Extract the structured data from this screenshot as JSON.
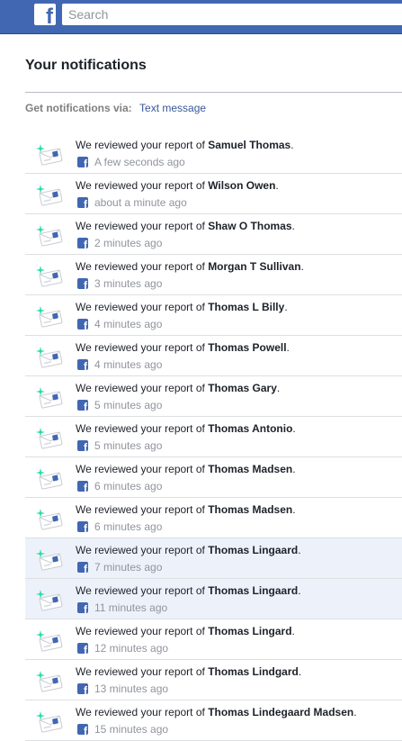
{
  "header": {
    "logo_glyph": "f",
    "search_placeholder": "Search",
    "brand_color": "#4267b2"
  },
  "page": {
    "title": "Your notifications",
    "via_label": "Get notifications via:",
    "via_link": "Text message"
  },
  "notification_icon": "support-inbox-envelope-icon",
  "notifications": [
    {
      "prefix": "We reviewed your report of ",
      "name": "Samuel Thomas",
      "suffix": ".",
      "time": "A few seconds ago",
      "unread": false
    },
    {
      "prefix": "We reviewed your report of ",
      "name": "Wilson Owen",
      "suffix": ".",
      "time": "about a minute ago",
      "unread": false
    },
    {
      "prefix": "We reviewed your report of ",
      "name": "Shaw O Thomas",
      "suffix": ".",
      "time": "2 minutes ago",
      "unread": false
    },
    {
      "prefix": "We reviewed your report of ",
      "name": "Morgan T Sullivan",
      "suffix": ".",
      "time": "3 minutes ago",
      "unread": false
    },
    {
      "prefix": "We reviewed your report of ",
      "name": "Thomas L Billy",
      "suffix": ".",
      "time": "4 minutes ago",
      "unread": false
    },
    {
      "prefix": "We reviewed your report of ",
      "name": "Thomas Powell",
      "suffix": ".",
      "time": "4 minutes ago",
      "unread": false
    },
    {
      "prefix": "We reviewed your report of ",
      "name": "Thomas Gary",
      "suffix": ".",
      "time": "5 minutes ago",
      "unread": false
    },
    {
      "prefix": "We reviewed your report of ",
      "name": "Thomas Antonio",
      "suffix": ".",
      "time": "5 minutes ago",
      "unread": false
    },
    {
      "prefix": "We reviewed your report of ",
      "name": "Thomas Madsen",
      "suffix": ".",
      "time": "6 minutes ago",
      "unread": false
    },
    {
      "prefix": "We reviewed your report of ",
      "name": "Thomas Madsen",
      "suffix": ".",
      "time": "6 minutes ago",
      "unread": false
    },
    {
      "prefix": "We reviewed your report of ",
      "name": "Thomas Lingaard",
      "suffix": ".",
      "time": "7 minutes ago",
      "unread": true
    },
    {
      "prefix": "We reviewed your report of ",
      "name": "Thomas Lingaard",
      "suffix": ".",
      "time": "11 minutes ago",
      "unread": true
    },
    {
      "prefix": "We reviewed your report of ",
      "name": "Thomas Lingard",
      "suffix": ".",
      "time": "12 minutes ago",
      "unread": false
    },
    {
      "prefix": "We reviewed your report of ",
      "name": "Thomas Lindgard",
      "suffix": ".",
      "time": "13 minutes ago",
      "unread": false
    },
    {
      "prefix": "We reviewed your report of ",
      "name": "Thomas Lindegaard Madsen",
      "suffix": ".",
      "time": "15 minutes ago",
      "unread": false
    }
  ]
}
